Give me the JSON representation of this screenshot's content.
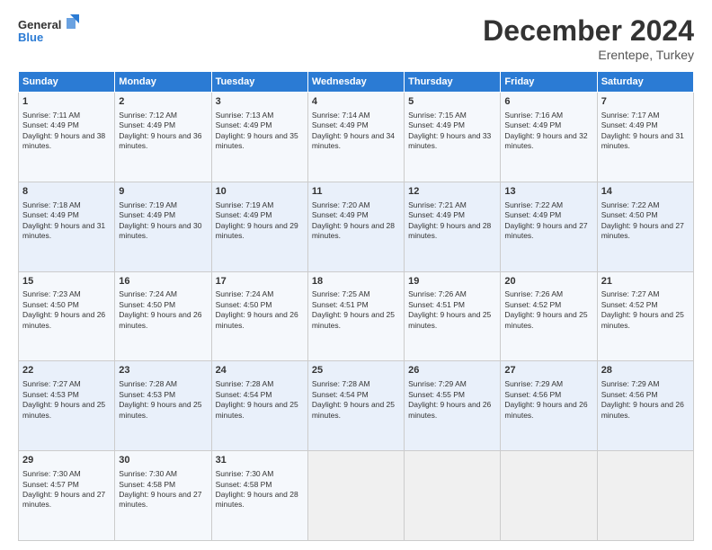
{
  "header": {
    "logo_line1": "General",
    "logo_line2": "Blue",
    "month_year": "December 2024",
    "location": "Erentepe, Turkey"
  },
  "weekdays": [
    "Sunday",
    "Monday",
    "Tuesday",
    "Wednesday",
    "Thursday",
    "Friday",
    "Saturday"
  ],
  "weeks": [
    [
      {
        "day": "1",
        "sunrise": "Sunrise: 7:11 AM",
        "sunset": "Sunset: 4:49 PM",
        "daylight": "Daylight: 9 hours and 38 minutes."
      },
      {
        "day": "2",
        "sunrise": "Sunrise: 7:12 AM",
        "sunset": "Sunset: 4:49 PM",
        "daylight": "Daylight: 9 hours and 36 minutes."
      },
      {
        "day": "3",
        "sunrise": "Sunrise: 7:13 AM",
        "sunset": "Sunset: 4:49 PM",
        "daylight": "Daylight: 9 hours and 35 minutes."
      },
      {
        "day": "4",
        "sunrise": "Sunrise: 7:14 AM",
        "sunset": "Sunset: 4:49 PM",
        "daylight": "Daylight: 9 hours and 34 minutes."
      },
      {
        "day": "5",
        "sunrise": "Sunrise: 7:15 AM",
        "sunset": "Sunset: 4:49 PM",
        "daylight": "Daylight: 9 hours and 33 minutes."
      },
      {
        "day": "6",
        "sunrise": "Sunrise: 7:16 AM",
        "sunset": "Sunset: 4:49 PM",
        "daylight": "Daylight: 9 hours and 32 minutes."
      },
      {
        "day": "7",
        "sunrise": "Sunrise: 7:17 AM",
        "sunset": "Sunset: 4:49 PM",
        "daylight": "Daylight: 9 hours and 31 minutes."
      }
    ],
    [
      {
        "day": "8",
        "sunrise": "Sunrise: 7:18 AM",
        "sunset": "Sunset: 4:49 PM",
        "daylight": "Daylight: 9 hours and 31 minutes."
      },
      {
        "day": "9",
        "sunrise": "Sunrise: 7:19 AM",
        "sunset": "Sunset: 4:49 PM",
        "daylight": "Daylight: 9 hours and 30 minutes."
      },
      {
        "day": "10",
        "sunrise": "Sunrise: 7:19 AM",
        "sunset": "Sunset: 4:49 PM",
        "daylight": "Daylight: 9 hours and 29 minutes."
      },
      {
        "day": "11",
        "sunrise": "Sunrise: 7:20 AM",
        "sunset": "Sunset: 4:49 PM",
        "daylight": "Daylight: 9 hours and 28 minutes."
      },
      {
        "day": "12",
        "sunrise": "Sunrise: 7:21 AM",
        "sunset": "Sunset: 4:49 PM",
        "daylight": "Daylight: 9 hours and 28 minutes."
      },
      {
        "day": "13",
        "sunrise": "Sunrise: 7:22 AM",
        "sunset": "Sunset: 4:49 PM",
        "daylight": "Daylight: 9 hours and 27 minutes."
      },
      {
        "day": "14",
        "sunrise": "Sunrise: 7:22 AM",
        "sunset": "Sunset: 4:50 PM",
        "daylight": "Daylight: 9 hours and 27 minutes."
      }
    ],
    [
      {
        "day": "15",
        "sunrise": "Sunrise: 7:23 AM",
        "sunset": "Sunset: 4:50 PM",
        "daylight": "Daylight: 9 hours and 26 minutes."
      },
      {
        "day": "16",
        "sunrise": "Sunrise: 7:24 AM",
        "sunset": "Sunset: 4:50 PM",
        "daylight": "Daylight: 9 hours and 26 minutes."
      },
      {
        "day": "17",
        "sunrise": "Sunrise: 7:24 AM",
        "sunset": "Sunset: 4:50 PM",
        "daylight": "Daylight: 9 hours and 26 minutes."
      },
      {
        "day": "18",
        "sunrise": "Sunrise: 7:25 AM",
        "sunset": "Sunset: 4:51 PM",
        "daylight": "Daylight: 9 hours and 25 minutes."
      },
      {
        "day": "19",
        "sunrise": "Sunrise: 7:26 AM",
        "sunset": "Sunset: 4:51 PM",
        "daylight": "Daylight: 9 hours and 25 minutes."
      },
      {
        "day": "20",
        "sunrise": "Sunrise: 7:26 AM",
        "sunset": "Sunset: 4:52 PM",
        "daylight": "Daylight: 9 hours and 25 minutes."
      },
      {
        "day": "21",
        "sunrise": "Sunrise: 7:27 AM",
        "sunset": "Sunset: 4:52 PM",
        "daylight": "Daylight: 9 hours and 25 minutes."
      }
    ],
    [
      {
        "day": "22",
        "sunrise": "Sunrise: 7:27 AM",
        "sunset": "Sunset: 4:53 PM",
        "daylight": "Daylight: 9 hours and 25 minutes."
      },
      {
        "day": "23",
        "sunrise": "Sunrise: 7:28 AM",
        "sunset": "Sunset: 4:53 PM",
        "daylight": "Daylight: 9 hours and 25 minutes."
      },
      {
        "day": "24",
        "sunrise": "Sunrise: 7:28 AM",
        "sunset": "Sunset: 4:54 PM",
        "daylight": "Daylight: 9 hours and 25 minutes."
      },
      {
        "day": "25",
        "sunrise": "Sunrise: 7:28 AM",
        "sunset": "Sunset: 4:54 PM",
        "daylight": "Daylight: 9 hours and 25 minutes."
      },
      {
        "day": "26",
        "sunrise": "Sunrise: 7:29 AM",
        "sunset": "Sunset: 4:55 PM",
        "daylight": "Daylight: 9 hours and 26 minutes."
      },
      {
        "day": "27",
        "sunrise": "Sunrise: 7:29 AM",
        "sunset": "Sunset: 4:56 PM",
        "daylight": "Daylight: 9 hours and 26 minutes."
      },
      {
        "day": "28",
        "sunrise": "Sunrise: 7:29 AM",
        "sunset": "Sunset: 4:56 PM",
        "daylight": "Daylight: 9 hours and 26 minutes."
      }
    ],
    [
      {
        "day": "29",
        "sunrise": "Sunrise: 7:30 AM",
        "sunset": "Sunset: 4:57 PM",
        "daylight": "Daylight: 9 hours and 27 minutes."
      },
      {
        "day": "30",
        "sunrise": "Sunrise: 7:30 AM",
        "sunset": "Sunset: 4:58 PM",
        "daylight": "Daylight: 9 hours and 27 minutes."
      },
      {
        "day": "31",
        "sunrise": "Sunrise: 7:30 AM",
        "sunset": "Sunset: 4:58 PM",
        "daylight": "Daylight: 9 hours and 28 minutes."
      },
      null,
      null,
      null,
      null
    ]
  ]
}
